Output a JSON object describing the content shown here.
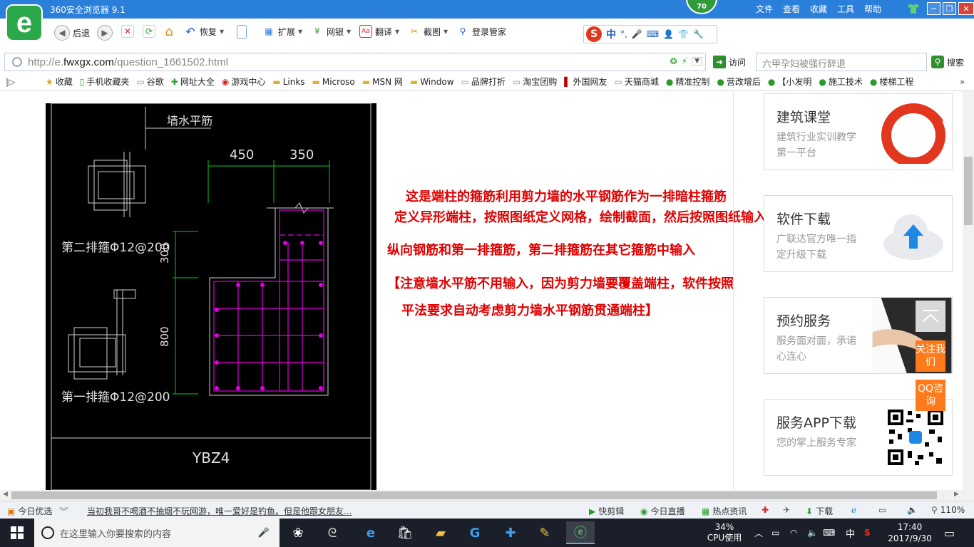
{
  "window": {
    "title": "360安全浏览器 9.1",
    "score": "70",
    "menu": [
      "文件",
      "查看",
      "收藏",
      "工具",
      "帮助"
    ]
  },
  "toolbar": {
    "back": "后退",
    "restore": "恢复",
    "extend": "扩展",
    "bank": "网银",
    "translate": "翻译",
    "screenshot": "截图",
    "login": "登录管家",
    "ime_label": "中"
  },
  "address": {
    "prefix": "http://e.",
    "domain": "fwxgx.com",
    "path": "/question_1661502.html",
    "go": "访问",
    "search_placeholder": "六甲孕妇被强行辞退",
    "search_btn": "搜索"
  },
  "favorites": [
    "收藏",
    "手机收藏夹",
    "谷歌",
    "网址大全",
    "游戏中心",
    "Links",
    "Microso",
    "MSN 网",
    "Window",
    "品牌打折",
    "淘宝团购",
    "外国网友",
    "天猫商城",
    "精准控制",
    "营改增后",
    "【小发明",
    "施工技术",
    "楼梯工程"
  ],
  "drawing": {
    "wall_label": "墙水平筋",
    "dim_450": "450",
    "dim_350": "350",
    "dim_300": "300",
    "dim_800": "800",
    "second_row": "第二排箍Φ12@200",
    "first_row": "第一排箍Φ12@200",
    "name": "YBZ4"
  },
  "notes": [
    "这是端柱的箍筋利用剪力墙的水平钢筋作为一排暗柱箍筋",
    "定义异形端柱，按照图纸定义网格，绘制截面，然后按照图纸输入",
    "纵向钢筋和第一排箍筋，第二排箍筋在其它箍筋中输入",
    "【注意墙水平筋不用输入，因为剪力墙要覆盖端柱，软件按照",
    "平法要求自动考虑剪力墙水平钢筋贯通端柱】"
  ],
  "sidebar": {
    "cards": [
      {
        "title": "建筑课堂",
        "sub": "建筑行业实训教学第一平台"
      },
      {
        "title": "软件下载",
        "sub": "广联达官方唯一指定升级下载"
      },
      {
        "title": "预约服务",
        "sub": "服务面对面，承诺心连心"
      },
      {
        "title": "服务APP下载",
        "sub": "您的掌上服务专家"
      }
    ],
    "follow": "关注我们",
    "qq": "QQ咨询"
  },
  "statusbar": {
    "today": "今日优选",
    "headline": "当初我哥不喝酒不抽烟不玩网游，唯一爱好是钓鱼。但是他跟女朋友...",
    "clip": "快剪辑",
    "live": "今日直播",
    "news": "热点资讯",
    "download": "下载",
    "zoom": "110%"
  },
  "taskbar": {
    "search_placeholder": "在这里输入你要搜索的内容",
    "cpu_pct": "34%",
    "cpu_label": "CPU使用",
    "ime": "中",
    "time": "17:40",
    "date": "2017/9/30"
  },
  "colors": {
    "titlebar": "#2a7fdb",
    "note_red": "#e00000",
    "cad_magenta": "#e000e0",
    "cad_green": "#00d000",
    "accent_orange": "#ff7a1a"
  }
}
